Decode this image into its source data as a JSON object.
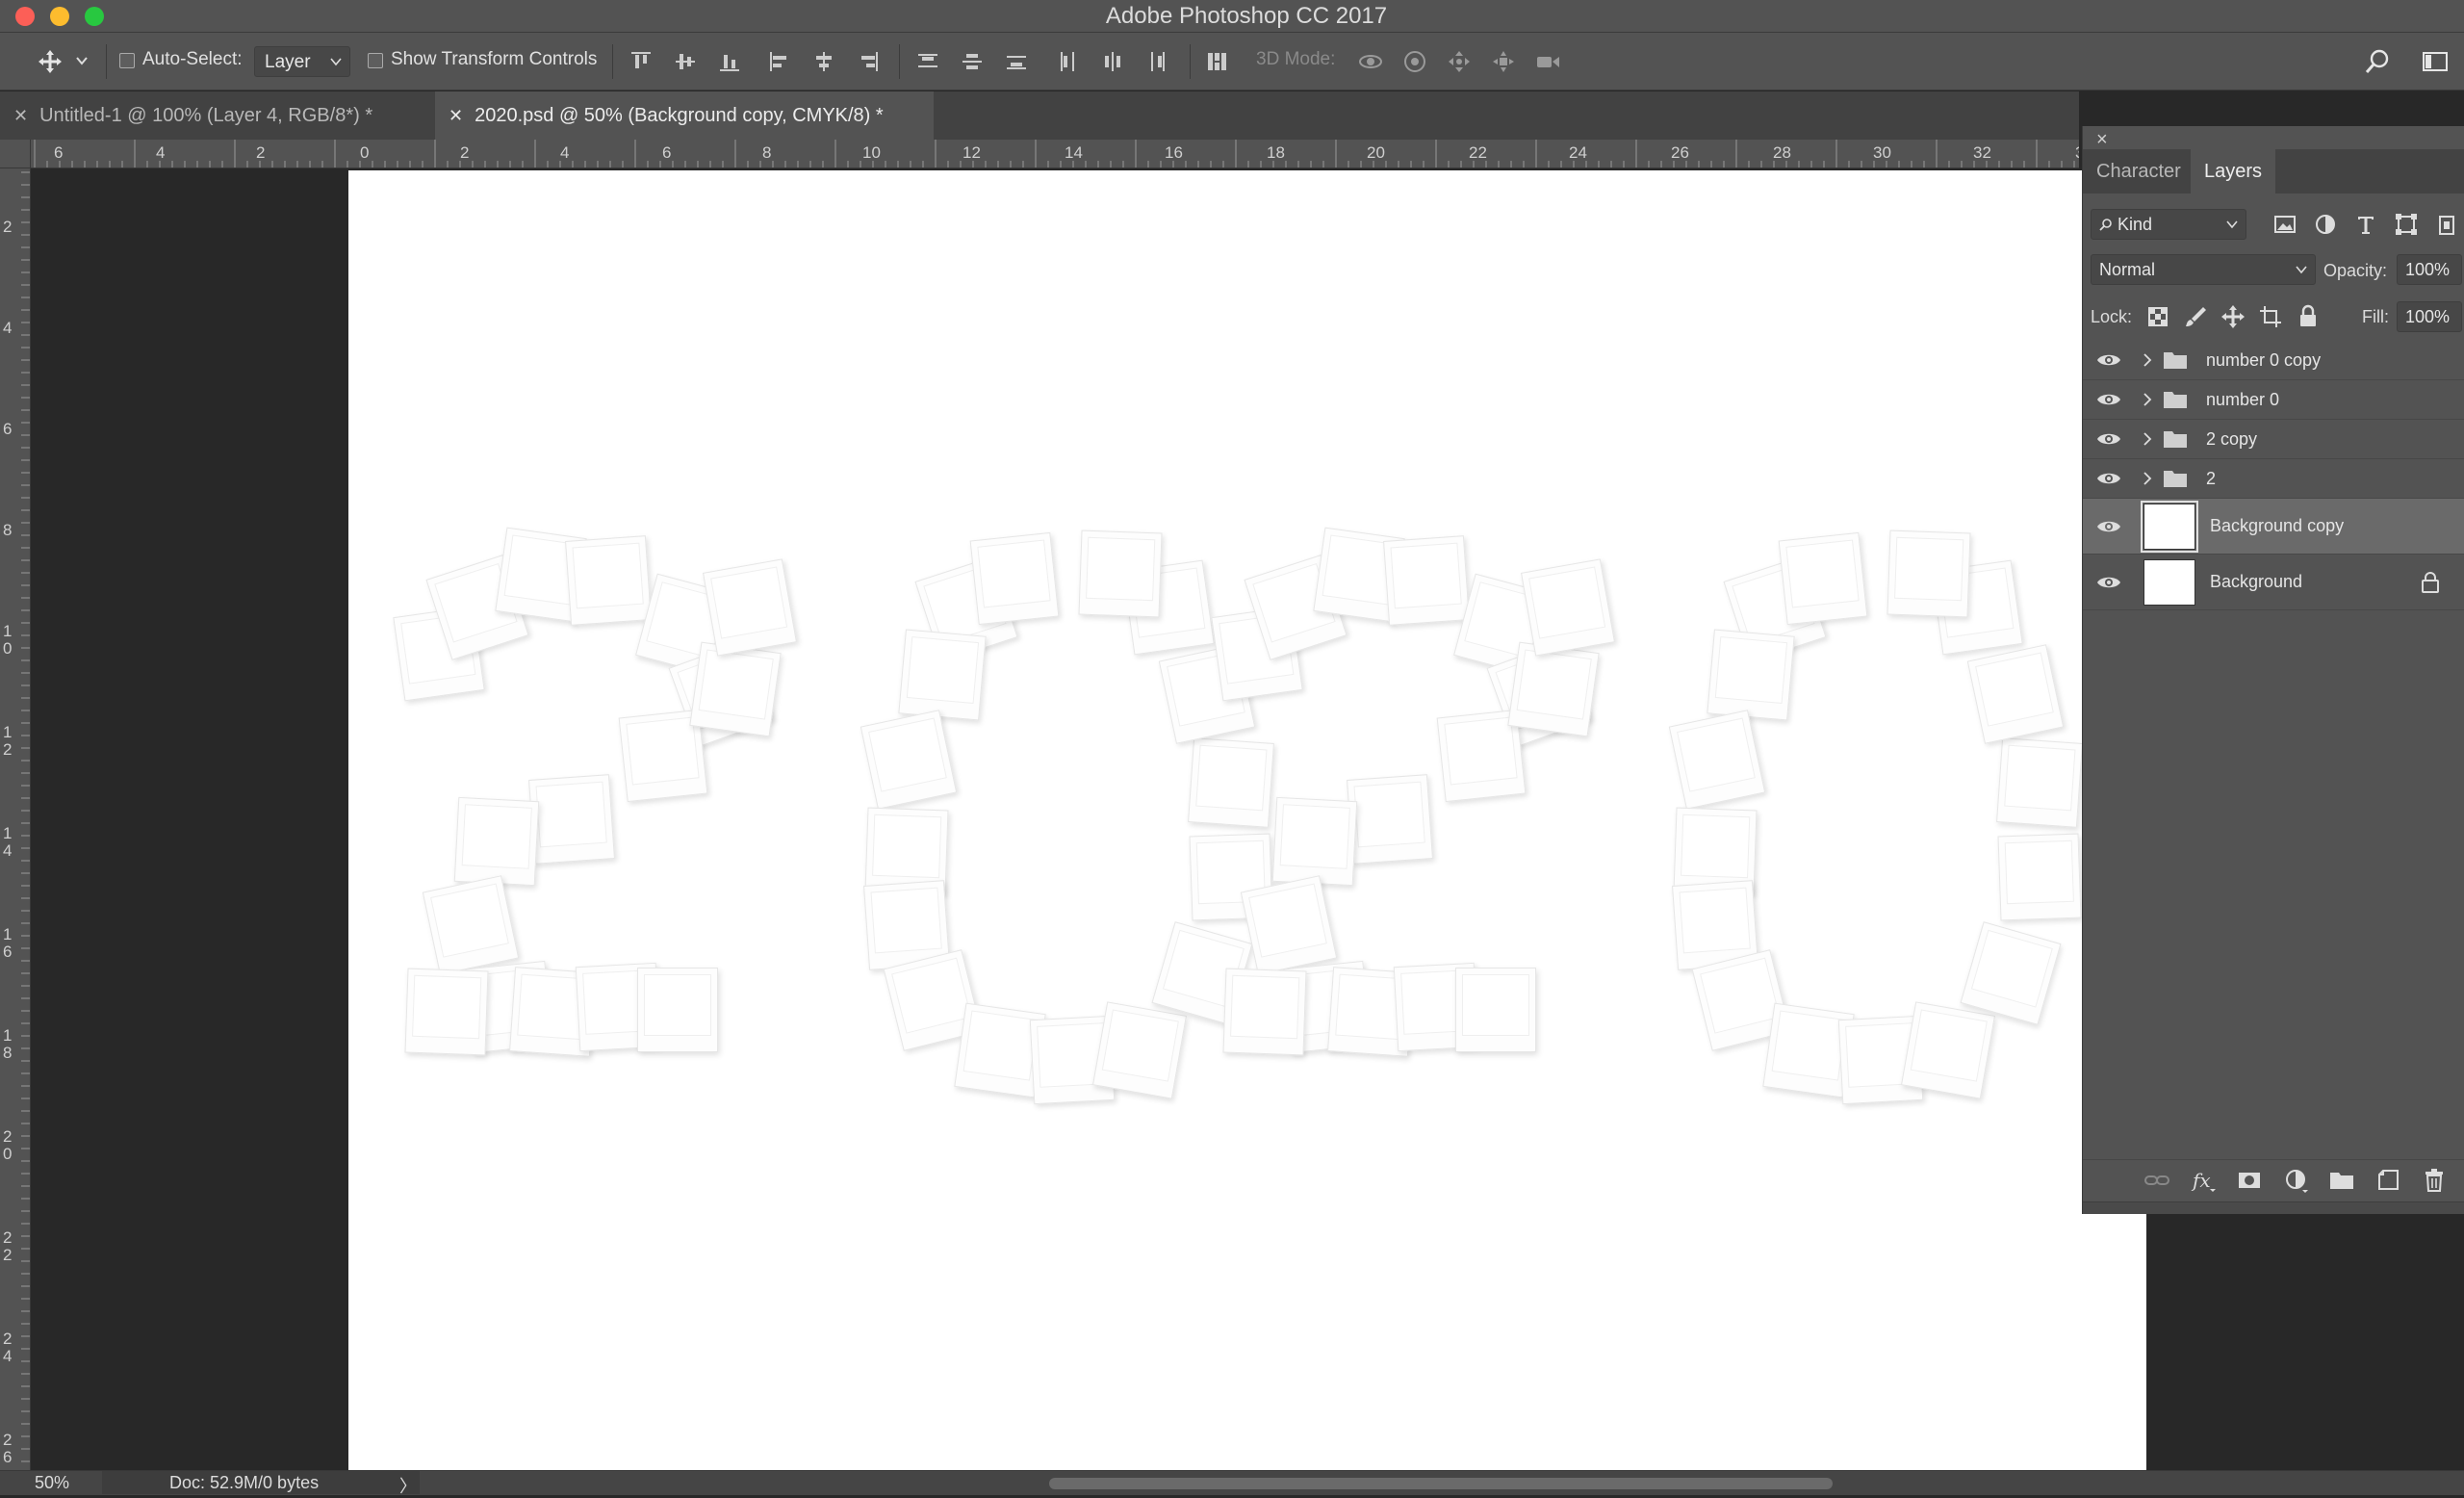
{
  "window": {
    "title": "Adobe Photoshop CC 2017"
  },
  "options_bar": {
    "auto_select_label": "Auto-Select:",
    "auto_select_value": "Layer",
    "show_transform_label": "Show Transform Controls",
    "mode_3d_label": "3D Mode:"
  },
  "doc_tabs": [
    {
      "label": "Untitled-1 @ 100% (Layer 4, RGB/8*) *",
      "active": false
    },
    {
      "label": "2020.psd @ 50% (Background copy, CMYK/8) *",
      "active": true
    }
  ],
  "rulers": {
    "horizontal": [
      "6",
      "4",
      "2",
      "0",
      "2",
      "4",
      "6",
      "8",
      "10",
      "12",
      "14",
      "16",
      "18",
      "20",
      "22",
      "24",
      "26",
      "28",
      "30",
      "32",
      "3"
    ],
    "vertical": [
      "2",
      "4",
      "6",
      "8",
      "1\n0",
      "1\n2",
      "1\n4",
      "1\n6",
      "1\n8",
      "2\n0",
      "2\n2",
      "2\n4",
      "2\n6"
    ]
  },
  "status_bar": {
    "zoom": "50%",
    "doc_info": "Doc: 52.9M/0 bytes",
    "arrow": "〉"
  },
  "panel": {
    "close_symbol": "×",
    "tabs": [
      {
        "label": "Character",
        "active": false
      },
      {
        "label": "Layers",
        "active": true
      }
    ],
    "filter_kind": "Kind",
    "blend_mode": "Normal",
    "opacity_label": "Opacity:",
    "opacity_value": "100%",
    "lock_label": "Lock:",
    "fill_label": "Fill:",
    "fill_value": "100%",
    "layers": [
      {
        "name": "number 0 copy",
        "type": "group"
      },
      {
        "name": "number 0",
        "type": "group"
      },
      {
        "name": "2 copy",
        "type": "group"
      },
      {
        "name": "2",
        "type": "group"
      },
      {
        "name": "Background copy",
        "type": "pixel",
        "selected": true
      },
      {
        "name": "Background",
        "type": "pixel",
        "locked": true
      }
    ]
  },
  "colors": {
    "ui_bg": "#535353",
    "canvas": "#ffffff",
    "pasteboard": "#282828",
    "selected_layer": "#6a6a6a"
  }
}
